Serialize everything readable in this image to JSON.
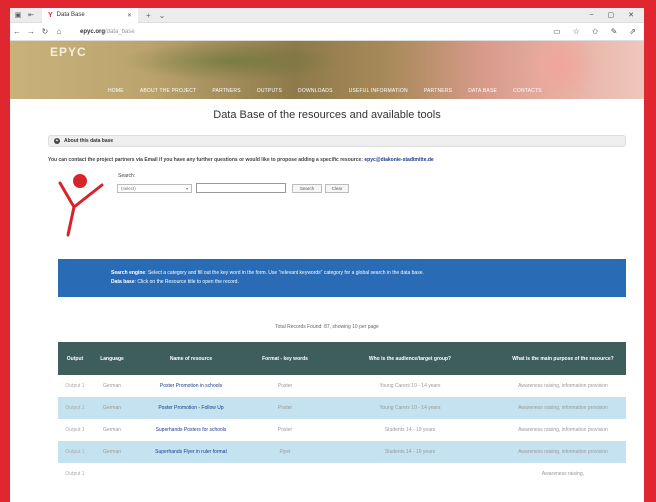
{
  "browser": {
    "tab_title": "Data Base",
    "url_domain": "epyc.org",
    "url_path": "/data_base"
  },
  "site": {
    "logo_text": "EPYC",
    "menu": [
      "HOME",
      "ABOUT THE PROJECT",
      "PARTNERS",
      "OUTPUTS",
      "DOWNLOADS",
      "USEFUL INFORMATION",
      "PARTNERS",
      "DATA BASE",
      "CONTACTS"
    ]
  },
  "page": {
    "title": "Data Base of the resources and available tools",
    "about_label": "About this data base",
    "contact_text": "You can contact the project partners via Email if you have any further questions or would like to propose adding a specific resource:",
    "contact_email": "epyc@diakonie-stadtmitte.de"
  },
  "search": {
    "label": "Search:",
    "select_value": "(select)",
    "input_value": "",
    "search_button": "Search",
    "clear_button": "Clear"
  },
  "info": {
    "engine_label": "Search engine",
    "engine_text": ": Select a category and fill out the key word in the form. Use \"relevant keywords\" category for a global search in the data base.",
    "db_label": "Data base",
    "db_text": ": Click on the Resource title to open the record."
  },
  "total_text": "Total Records Found: 87, showing 10 per page",
  "table": {
    "headers": [
      "Output",
      "Language",
      "Name of resource",
      "Format - key words",
      "Who is the audience/target group?",
      "What is the main purpose of the resource?"
    ],
    "rows": [
      {
        "output": "Output 1",
        "language": "German",
        "name": "Poster Promotion in schools",
        "format": "Poster",
        "audience": "Young Carers 10 - 14 years",
        "purpose": "Awareness raising, information provision"
      },
      {
        "output": "Output 1",
        "language": "German",
        "name": "Poster Promotion - Follow Up",
        "format": "Poster",
        "audience": "Young Carers 10 - 14 years",
        "purpose": "Awareness raising, information provision"
      },
      {
        "output": "Output 1",
        "language": "German",
        "name": "Superhands Posters for schools",
        "format": "Poster",
        "audience": "Students 14 - 19 years",
        "purpose": "Awareness raising, information provision"
      },
      {
        "output": "Output 1",
        "language": "German",
        "name": "Superhands Flyer in ruler format",
        "format": "Flyer",
        "audience": "Students 14 - 19 years",
        "purpose": "Awareness raising, information provision"
      },
      {
        "output": "Output 1",
        "language": "",
        "name": "",
        "format": "",
        "audience": "",
        "purpose": "Awareness raising,"
      }
    ]
  }
}
